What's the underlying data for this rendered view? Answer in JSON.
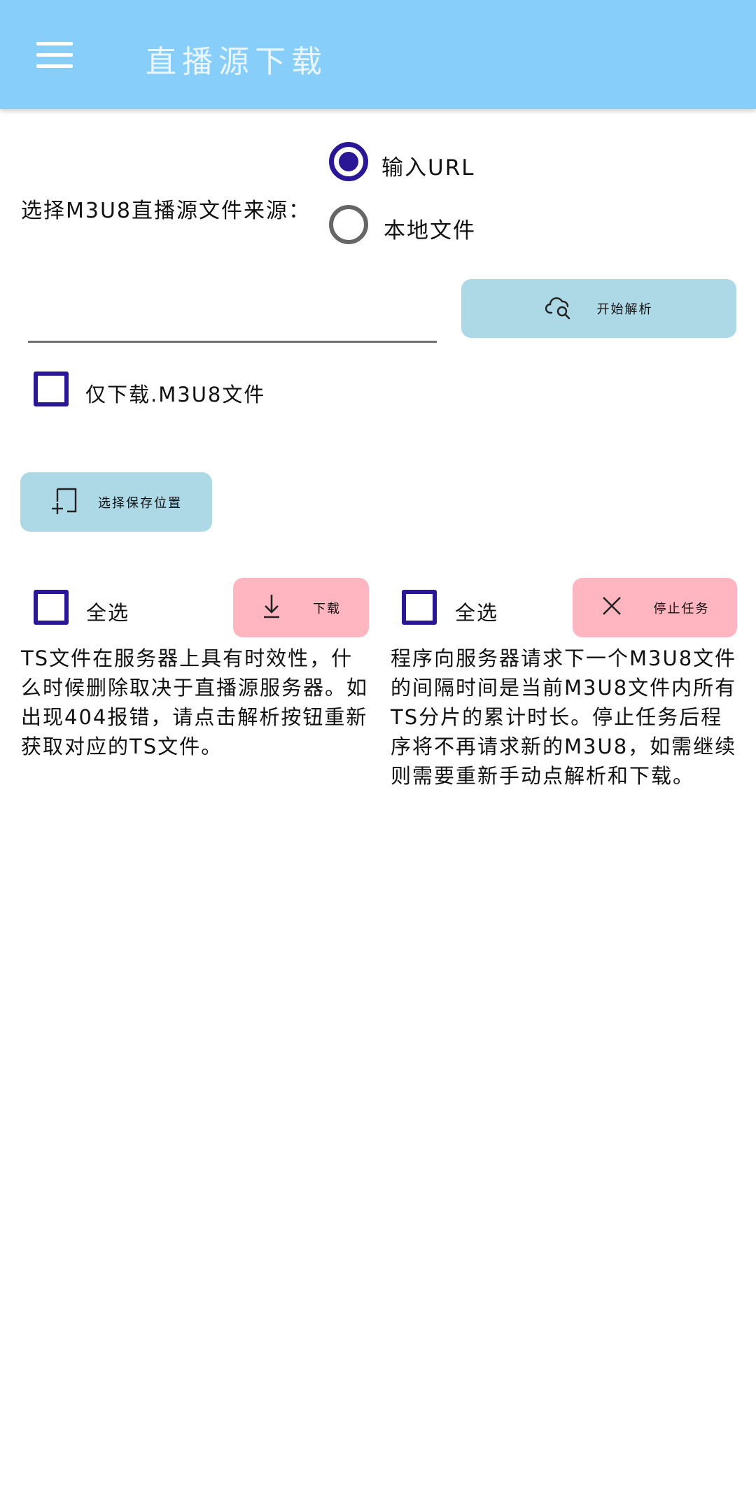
{
  "app": {
    "title": "直播源下载"
  },
  "source": {
    "label": "选择M3U8直播源文件来源：",
    "options": [
      {
        "label": "输入URL",
        "checked": true
      },
      {
        "label": "本地文件",
        "checked": false
      }
    ]
  },
  "url_input": {
    "value": "",
    "placeholder": ""
  },
  "parse_button": {
    "label": "开始解析",
    "icon": "cloud-search-icon"
  },
  "only_m3u8": {
    "label": "仅下载.M3U8文件",
    "checked": false
  },
  "save_location_button": {
    "label": "选择保存位置",
    "icon": "folder-plus-icon"
  },
  "download_panel": {
    "select_all_label": "全选",
    "button_label": "下载",
    "button_icon": "download-icon",
    "note": "TS文件在服务器上具有时效性，什么时候删除取决于直播源服务器。如出现404报错，请点击解析按钮重新获取对应的TS文件。"
  },
  "stop_panel": {
    "select_all_label": "全选",
    "button_label": "停止任务",
    "button_icon": "close-icon",
    "note": "程序向服务器请求下一个M3U8文件的间隔时间是当前M3U8文件内所有TS分片的累计时长。停止任务后程序将不再请求新的M3U8，如需继续则需要重新手动点解析和下载。"
  },
  "colors": {
    "appbar": "#87cefa",
    "accent": "#2a1796",
    "button_blue": "#add8e6",
    "button_pink": "#ffb6c1"
  }
}
